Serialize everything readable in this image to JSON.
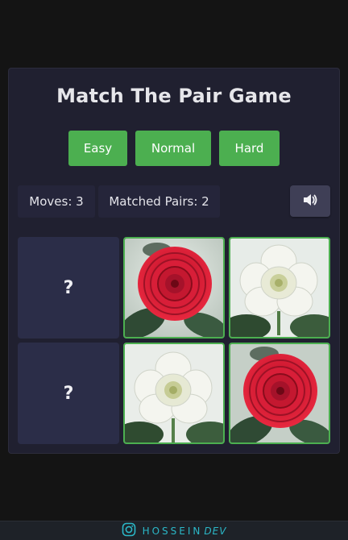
{
  "game": {
    "title": "Match The Pair Game",
    "difficulty_buttons": [
      "Easy",
      "Normal",
      "Hard"
    ],
    "stats": {
      "moves": "Moves: 3",
      "matched_pairs": "Matched Pairs: 2"
    },
    "cards": [
      {
        "state": "hidden",
        "face": "?"
      },
      {
        "state": "matched",
        "face": "red-camellia"
      },
      {
        "state": "matched",
        "face": "white-begonia"
      },
      {
        "state": "hidden",
        "face": "?"
      },
      {
        "state": "matched",
        "face": "white-begonia"
      },
      {
        "state": "matched",
        "face": "red-camellia"
      }
    ]
  },
  "footer": {
    "brand_main": "HOSSEIN",
    "brand_suffix": "DEV",
    "icon": "instagram-icon"
  },
  "colors": {
    "accent": "#4caf50",
    "background": "#141414",
    "panel": "#202030",
    "card_back": "#2b2d48",
    "footer_text": "#2bb8c8"
  }
}
